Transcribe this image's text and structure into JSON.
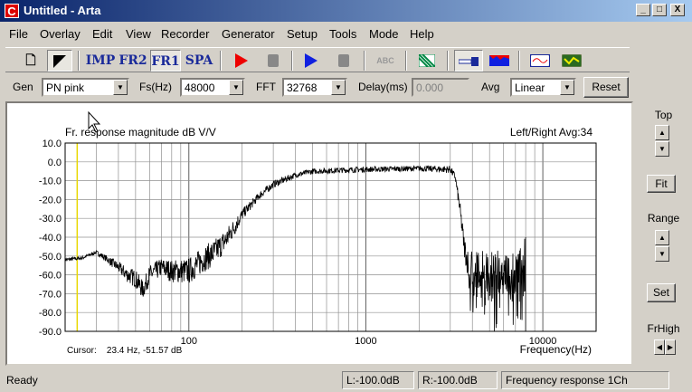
{
  "window": {
    "title": "Untitled - Arta",
    "app_icon": "C",
    "min": "_",
    "max": "□",
    "close": "X"
  },
  "menu": [
    "File",
    "Overlay",
    "Edit",
    "View",
    "Recorder",
    "Generator",
    "Setup",
    "Tools",
    "Mode",
    "Help"
  ],
  "toolbar": {
    "imp": "IMP",
    "fr2": "FR2",
    "fr1": "FR1",
    "spa": "SPA",
    "abc": "ABC"
  },
  "controls": {
    "gen_label": "Gen",
    "gen_value": "PN pink",
    "fs_label": "Fs(Hz)",
    "fs_value": "48000",
    "fft_label": "FFT",
    "fft_value": "32768",
    "delay_label": "Delay(ms)",
    "delay_value": "0.000",
    "avg_label": "Avg",
    "avg_value": "Linear",
    "reset": "Reset"
  },
  "right_panel": {
    "top": "Top",
    "fit": "Fit",
    "range": "Range",
    "set": "Set",
    "frhigh": "FrHigh"
  },
  "status": {
    "ready": "Ready",
    "left": "L:-100.0dB",
    "right": "R:-100.0dB",
    "mode": "Frequency response 1Ch"
  },
  "chart_data": {
    "type": "line",
    "title": "Fr. response magnitude dB V/V",
    "title_right": "Left/Right  Avg:34",
    "xlabel": "Frequency(Hz)",
    "xscale": "log",
    "xlim": [
      20,
      20000
    ],
    "xticks": [
      {
        "v": 100,
        "label": "100"
      },
      {
        "v": 1000,
        "label": "1000"
      },
      {
        "v": 10000,
        "label": "10000"
      }
    ],
    "ylabel": "",
    "ylim": [
      -90,
      10
    ],
    "yticks": [
      "10.0",
      "0.0",
      "-10.0",
      "-20.0",
      "-30.0",
      "-40.0",
      "-50.0",
      "-60.0",
      "-70.0",
      "-80.0",
      "-90.0"
    ],
    "cursor_text": "Cursor:    23.4 Hz, -51.57 dB",
    "cursor_hz": 23.4,
    "series": [
      {
        "name": "Left/Right",
        "color": "#000000",
        "points": [
          [
            20,
            -52,
            1
          ],
          [
            25,
            -51,
            1
          ],
          [
            30,
            -48,
            1
          ],
          [
            35,
            -52,
            2
          ],
          [
            40,
            -56,
            3
          ],
          [
            45,
            -60,
            4
          ],
          [
            50,
            -62,
            5
          ],
          [
            55,
            -68,
            5
          ],
          [
            60,
            -60,
            5
          ],
          [
            70,
            -56,
            5
          ],
          [
            80,
            -58,
            6
          ],
          [
            100,
            -58,
            7
          ],
          [
            120,
            -52,
            7
          ],
          [
            140,
            -48,
            7
          ],
          [
            160,
            -42,
            6
          ],
          [
            180,
            -35,
            5
          ],
          [
            200,
            -28,
            3
          ],
          [
            250,
            -18,
            2
          ],
          [
            300,
            -12,
            2
          ],
          [
            400,
            -7,
            1.5
          ],
          [
            500,
            -5,
            1.5
          ],
          [
            700,
            -4.5,
            1.5
          ],
          [
            1000,
            -4,
            1.5
          ],
          [
            2000,
            -3.5,
            1.5
          ],
          [
            3000,
            -4,
            2
          ],
          [
            3200,
            -8,
            2
          ],
          [
            3400,
            -25,
            4
          ],
          [
            3600,
            -45,
            6
          ],
          [
            3800,
            -55,
            8
          ],
          [
            5000,
            -57,
            10
          ],
          [
            7000,
            -57,
            12
          ],
          [
            7800,
            -55,
            14
          ],
          [
            8000,
            -45,
            20
          ]
        ]
      }
    ]
  }
}
